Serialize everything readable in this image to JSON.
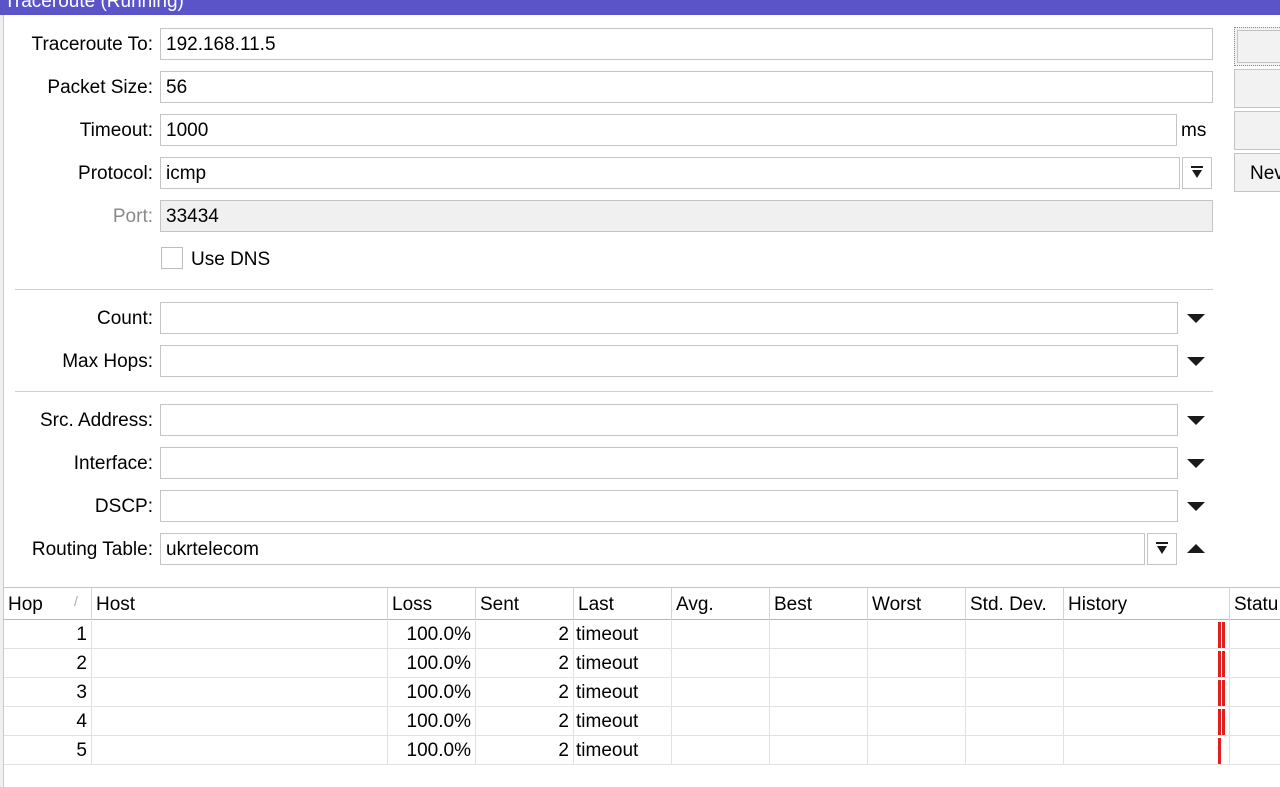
{
  "window": {
    "title": "Traceroute (Running)"
  },
  "form": {
    "traceroute_to": {
      "label": "Traceroute To:",
      "value": "192.168.11.5"
    },
    "packet_size": {
      "label": "Packet Size:",
      "value": "56"
    },
    "timeout": {
      "label": "Timeout:",
      "value": "1000",
      "unit": "ms"
    },
    "protocol": {
      "label": "Protocol:",
      "value": "icmp"
    },
    "port": {
      "label": "Port:",
      "value": "33434"
    },
    "use_dns": {
      "label": "Use DNS",
      "checked": false
    },
    "count": {
      "label": "Count:",
      "value": ""
    },
    "max_hops": {
      "label": "Max Hops:",
      "value": ""
    },
    "src_address": {
      "label": "Src. Address:",
      "value": ""
    },
    "interface": {
      "label": "Interface:",
      "value": ""
    },
    "dscp": {
      "label": "DSCP:",
      "value": ""
    },
    "routing_table": {
      "label": "Routing Table:",
      "value": "ukrtelecom"
    }
  },
  "side_buttons": [
    "",
    "",
    "",
    "Nev"
  ],
  "table": {
    "columns": [
      "Hop",
      "Host",
      "Loss",
      "Sent",
      "Last",
      "Avg.",
      "Best",
      "Worst",
      "Std. Dev.",
      "History",
      "Statu"
    ],
    "sort_indicator": "/",
    "rows": [
      {
        "hop": "1",
        "host": "",
        "loss": "100.0%",
        "sent": "2",
        "last": "timeout",
        "avg": "",
        "best": "",
        "worst": "",
        "std_dev": "",
        "history_bars": 2
      },
      {
        "hop": "2",
        "host": "",
        "loss": "100.0%",
        "sent": "2",
        "last": "timeout",
        "avg": "",
        "best": "",
        "worst": "",
        "std_dev": "",
        "history_bars": 2
      },
      {
        "hop": "3",
        "host": "",
        "loss": "100.0%",
        "sent": "2",
        "last": "timeout",
        "avg": "",
        "best": "",
        "worst": "",
        "std_dev": "",
        "history_bars": 2
      },
      {
        "hop": "4",
        "host": "",
        "loss": "100.0%",
        "sent": "2",
        "last": "timeout",
        "avg": "",
        "best": "",
        "worst": "",
        "std_dev": "",
        "history_bars": 2
      },
      {
        "hop": "5",
        "host": "",
        "loss": "100.0%",
        "sent": "2",
        "last": "timeout",
        "avg": "",
        "best": "",
        "worst": "",
        "std_dev": "",
        "history_bars": 1
      }
    ]
  },
  "colors": {
    "titlebar": "#5a54c8",
    "history_loss": "#e02020"
  }
}
